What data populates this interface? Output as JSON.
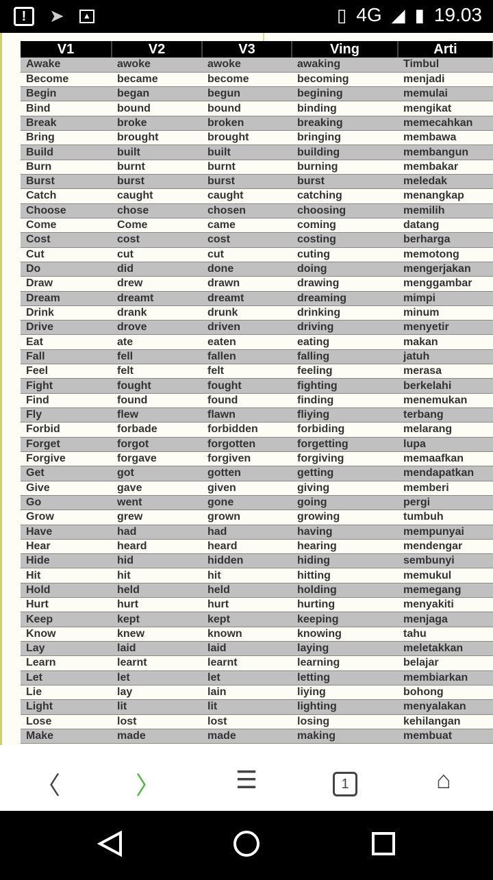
{
  "status": {
    "time": "19.03",
    "network": "4G",
    "icons": [
      "alert-icon",
      "send-icon",
      "image-icon",
      "vibrate-icon",
      "signal-icon",
      "battery-icon"
    ]
  },
  "table": {
    "headers": [
      "V1",
      "V2",
      "V3",
      "Ving",
      "Arti"
    ],
    "rows": [
      [
        "Awake",
        "awoke",
        "awoke",
        "awaking",
        "Timbul"
      ],
      [
        "Become",
        "became",
        "become",
        "becoming",
        "menjadi"
      ],
      [
        "Begin",
        "began",
        "begun",
        "begining",
        "memulai"
      ],
      [
        "Bind",
        "bound",
        "bound",
        "binding",
        "mengikat"
      ],
      [
        "Break",
        "broke",
        "broken",
        "breaking",
        "memecahkan"
      ],
      [
        "Bring",
        "brought",
        "brought",
        "bringing",
        "membawa"
      ],
      [
        "Build",
        "built",
        "built",
        "building",
        "membangun"
      ],
      [
        "Burn",
        "burnt",
        "burnt",
        "burning",
        "membakar"
      ],
      [
        "Burst",
        "burst",
        "burst",
        "burst",
        "meledak"
      ],
      [
        "Catch",
        "caught",
        "caught",
        "catching",
        "menangkap"
      ],
      [
        "Choose",
        "chose",
        "chosen",
        "choosing",
        "memilih"
      ],
      [
        "Come",
        "Come",
        "came",
        "coming",
        "datang"
      ],
      [
        "Cost",
        "cost",
        "cost",
        "costing",
        "berharga"
      ],
      [
        "Cut",
        "cut",
        "cut",
        "cuting",
        "memotong"
      ],
      [
        "Do",
        "did",
        "done",
        "doing",
        "mengerjakan"
      ],
      [
        "Draw",
        "drew",
        "drawn",
        "drawing",
        "menggambar"
      ],
      [
        "Dream",
        "dreamt",
        "dreamt",
        "dreaming",
        "mimpi"
      ],
      [
        "Drink",
        "drank",
        "drunk",
        "drinking",
        "minum"
      ],
      [
        "Drive",
        "drove",
        "driven",
        "driving",
        "menyetir"
      ],
      [
        "Eat",
        "ate",
        "eaten",
        "eating",
        "makan"
      ],
      [
        "Fall",
        "fell",
        "fallen",
        "falling",
        "jatuh"
      ],
      [
        "Feel",
        "felt",
        "felt",
        "feeling",
        "merasa"
      ],
      [
        "Fight",
        "fought",
        "fought",
        "fighting",
        "berkelahi"
      ],
      [
        "Find",
        "found",
        "found",
        "finding",
        "menemukan"
      ],
      [
        "Fly",
        "flew",
        "flawn",
        "fliying",
        "terbang"
      ],
      [
        "Forbid",
        "forbade",
        "forbidden",
        "forbiding",
        "melarang"
      ],
      [
        "Forget",
        "forgot",
        "forgotten",
        "forgetting",
        "lupa"
      ],
      [
        "Forgive",
        "forgave",
        "forgiven",
        "forgiving",
        "memaafkan"
      ],
      [
        "Get",
        "got",
        "gotten",
        "getting",
        "mendapatkan"
      ],
      [
        "Give",
        "gave",
        "given",
        "giving",
        "memberi"
      ],
      [
        "Go",
        "went",
        "gone",
        "going",
        "pergi"
      ],
      [
        "Grow",
        "grew",
        "grown",
        "growing",
        "tumbuh"
      ],
      [
        "Have",
        "had",
        "had",
        "having",
        "mempunyai"
      ],
      [
        "Hear",
        "heard",
        "heard",
        "hearing",
        "mendengar"
      ],
      [
        "Hide",
        "hid",
        "hidden",
        "hiding",
        "sembunyi"
      ],
      [
        "Hit",
        "hit",
        "hit",
        "hitting",
        "memukul"
      ],
      [
        "Hold",
        "held",
        "held",
        "holding",
        "memegang"
      ],
      [
        "Hurt",
        "hurt",
        "hurt",
        "hurting",
        "menyakiti"
      ],
      [
        "Keep",
        "kept",
        "kept",
        "keeping",
        "menjaga"
      ],
      [
        "Know",
        "knew",
        "known",
        "knowing",
        "tahu"
      ],
      [
        "Lay",
        "laid",
        "laid",
        "laying",
        "meletakkan"
      ],
      [
        "Learn",
        "learnt",
        "learnt",
        "learning",
        "belajar"
      ],
      [
        "Let",
        "let",
        "let",
        "letting",
        "membiarkan"
      ],
      [
        "Lie",
        "lay",
        "lain",
        "liying",
        "bohong"
      ],
      [
        "Light",
        "lit",
        "lit",
        "lighting",
        "menyalakan"
      ],
      [
        "Lose",
        "lost",
        "lost",
        "losing",
        "kehilangan"
      ],
      [
        "Make",
        "made",
        "made",
        "making",
        "membuat"
      ]
    ]
  },
  "browser_nav": {
    "tab_count": "1",
    "icons": [
      "back-icon",
      "forward-icon",
      "menu-icon",
      "tabs-icon",
      "home-icon"
    ],
    "forward_color": "#4cbb3c"
  },
  "system_nav": {
    "icons": [
      "back-triangle-icon",
      "home-circle-icon",
      "recents-square-icon"
    ]
  }
}
